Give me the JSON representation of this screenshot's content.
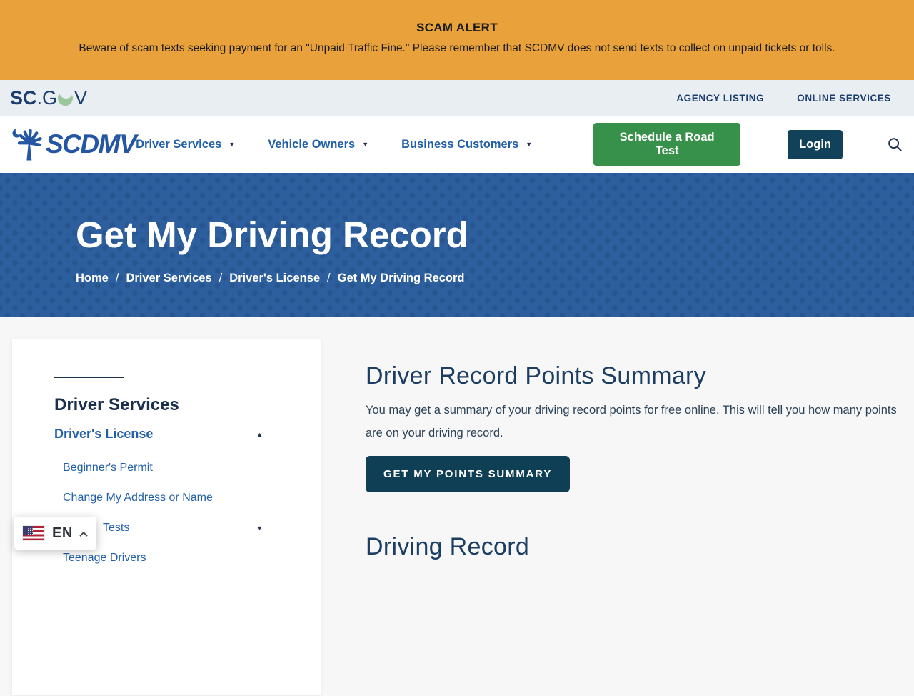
{
  "alert": {
    "title": "SCAM ALERT",
    "message": "Beware of scam texts seeking payment for an \"Unpaid Traffic Fine.\" Please remember that SCDMV does not send texts to collect on unpaid tickets or tolls."
  },
  "utility_bar": {
    "logo": {
      "sc": "SC",
      "mid": ".G",
      "v": "V"
    },
    "links": [
      {
        "label": "AGENCY LISTING"
      },
      {
        "label": "ONLINE SERVICES"
      }
    ]
  },
  "nav": {
    "brand": "SCDMV",
    "items": [
      {
        "label": "Driver Services"
      },
      {
        "label": "Vehicle Owners"
      },
      {
        "label": "Business Customers"
      }
    ],
    "road_test_button": "Schedule a Road Test",
    "login_button": "Login"
  },
  "hero": {
    "title": "Get My Driving Record",
    "separator": "/",
    "breadcrumbs": [
      {
        "label": "Home"
      },
      {
        "label": "Driver Services"
      },
      {
        "label": "Driver's License"
      },
      {
        "label": "Get My Driving Record"
      }
    ]
  },
  "sidebar": {
    "heading": "Driver Services",
    "sections": [
      {
        "label": "Driver's License",
        "expanded": true,
        "children": [
          {
            "label": "Beginner's Permit"
          },
          {
            "label": "Change My Address or Name"
          },
          {
            "label": "Tests",
            "has_children": true,
            "occluded": true
          },
          {
            "label": "Teenage Drivers"
          }
        ]
      }
    ]
  },
  "language_selector": {
    "code": "EN",
    "flag": "us-flag"
  },
  "main": {
    "sections": [
      {
        "heading": "Driver Record Points Summary",
        "body": "You may get a summary of your driving record points for free online. This will tell you how many points are on your driving record.",
        "button": "GET MY POINTS SUMMARY"
      },
      {
        "heading": "Driving Record"
      }
    ]
  },
  "ui": {
    "caret_down": "▼",
    "caret_up": "▲"
  },
  "colors": {
    "alert_bg": "#E9A23B",
    "utility_bg": "#E9EEF3",
    "navy": "#1B3E6E",
    "brand_blue": "#2456A4",
    "link_blue": "#2160A8",
    "green_button": "#38914A",
    "login_button": "#114259",
    "hero_bg": "#2D5F9E",
    "hero_dot": "#265590",
    "cta_button": "#0E3F55",
    "crescent_green": "#9CC79B"
  }
}
